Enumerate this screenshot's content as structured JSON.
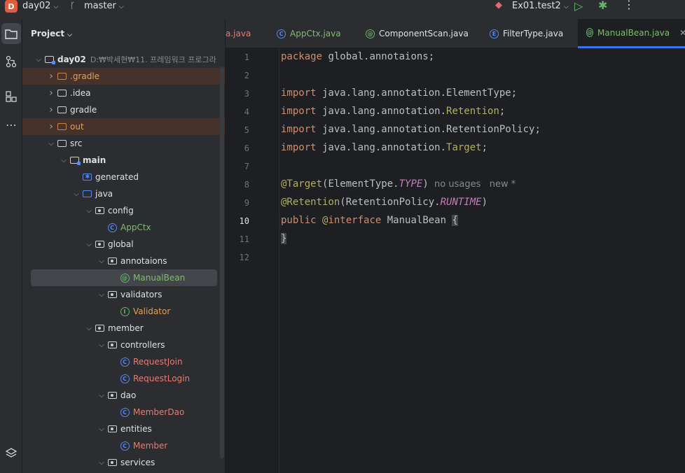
{
  "titlebar": {
    "project_badge": "D",
    "project_name": "day02",
    "branch": "master",
    "run_config": "Ex01.test2"
  },
  "project_panel": {
    "title": "Project",
    "root_path": "D:₩박세현₩11. 프레임워크 프로그라",
    "tree": [
      {
        "label": "day02",
        "kind": "module"
      },
      {
        "label": ".gradle",
        "kind": "folder-excluded"
      },
      {
        "label": ".idea",
        "kind": "folder"
      },
      {
        "label": "gradle",
        "kind": "folder"
      },
      {
        "label": "out",
        "kind": "folder-excluded"
      },
      {
        "label": "src",
        "kind": "folder"
      },
      {
        "label": "main",
        "kind": "source-root"
      },
      {
        "label": "generated",
        "kind": "generated-folder"
      },
      {
        "label": "java",
        "kind": "source-folder"
      },
      {
        "label": "config",
        "kind": "package"
      },
      {
        "label": "AppCtx",
        "kind": "class"
      },
      {
        "label": "global",
        "kind": "package"
      },
      {
        "label": "annotaions",
        "kind": "package"
      },
      {
        "label": "ManualBean",
        "kind": "annotation"
      },
      {
        "label": "validators",
        "kind": "package"
      },
      {
        "label": "Validator",
        "kind": "interface"
      },
      {
        "label": "member",
        "kind": "package"
      },
      {
        "label": "controllers",
        "kind": "package"
      },
      {
        "label": "RequestJoin",
        "kind": "class"
      },
      {
        "label": "RequestLogin",
        "kind": "class"
      },
      {
        "label": "dao",
        "kind": "package"
      },
      {
        "label": "MemberDao",
        "kind": "class"
      },
      {
        "label": "entities",
        "kind": "package"
      },
      {
        "label": "Member",
        "kind": "class"
      },
      {
        "label": "services",
        "kind": "package"
      }
    ]
  },
  "tabs": [
    {
      "label": "a.java"
    },
    {
      "label": "AppCtx.java"
    },
    {
      "label": "ComponentScan.java"
    },
    {
      "label": "FilterType.java"
    },
    {
      "label": "ManualBean.java",
      "active": true
    }
  ],
  "editor": {
    "line_numbers": [
      "1",
      "2",
      "3",
      "4",
      "5",
      "6",
      "7",
      "8",
      "9",
      "10",
      "11",
      "12"
    ],
    "current_line": "10",
    "code": {
      "l1_kw": "package",
      "l1_rest": " global.annotaions;",
      "import_kw": "import",
      "l3_a": " java.lang.annotation.ElementType;",
      "l4_a": " java.lang.annotation.",
      "l4_b": "Retention",
      "l4_c": ";",
      "l5_a": " java.lang.annotation.RetentionPolicy;",
      "l6_a": " java.lang.annotation.",
      "l6_b": "Target",
      "l6_c": ";",
      "l8_ann": "@Target",
      "l8_a": "(ElementType.",
      "l8_const": "TYPE",
      "l8_b": ")",
      "l8_hint": "  no usages   new *",
      "l9_ann": "@Retention",
      "l9_a": "(RetentionPolicy.",
      "l9_const": "RUNTIME",
      "l9_b": ")",
      "l10_kw1": "public",
      "l10_ann": "@",
      "l10_kw2": "interface",
      "l10_name": " ManualBean ",
      "l10_brace": "{",
      "l11": "}"
    },
    "hint_color": "#868a91"
  },
  "colors": {
    "keyword": "#cf8e6d",
    "annotation": "#b3ae60",
    "constant": "#c77dbb",
    "accent": "#3574f0"
  }
}
